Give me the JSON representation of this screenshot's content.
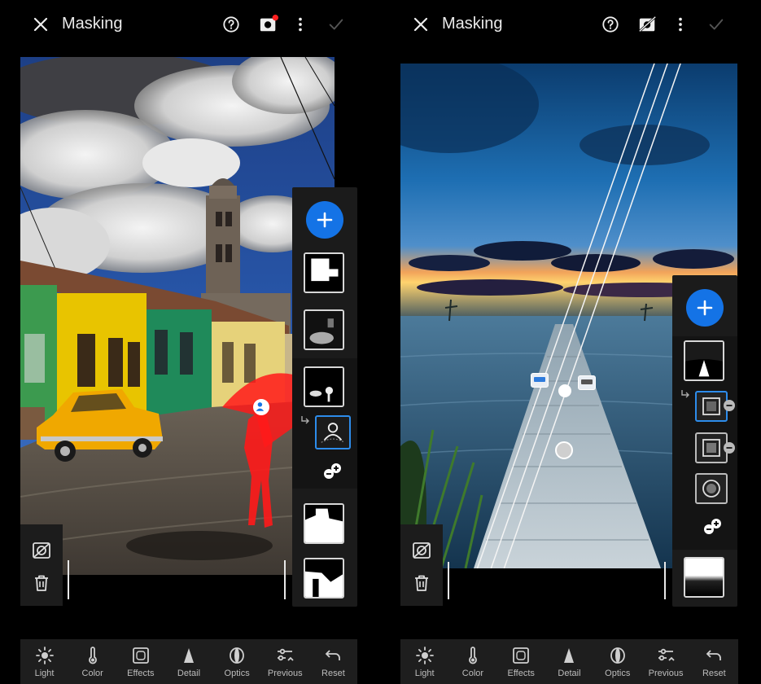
{
  "left_screen": {
    "title": "Masking",
    "toolbar": [
      "Light",
      "Color",
      "Effects",
      "Detail",
      "Optics",
      "Previous",
      "Reset"
    ]
  },
  "right_screen": {
    "title": "Masking",
    "toolbar": [
      "Light",
      "Color",
      "Effects",
      "Detail",
      "Optics",
      "Previous",
      "Reset"
    ]
  },
  "icons": {
    "close": "close-icon",
    "help": "help-icon",
    "mask_overlay": "mask-overlay-icon",
    "more": "more-vertical-icon",
    "done": "checkmark-icon",
    "add": "plus-icon",
    "invert": "invert-mask-icon",
    "delete": "trash-icon"
  },
  "colors": {
    "accent": "#1473e6",
    "overlay_red": "#ff1a1a",
    "panel": "#1b1b1b"
  }
}
